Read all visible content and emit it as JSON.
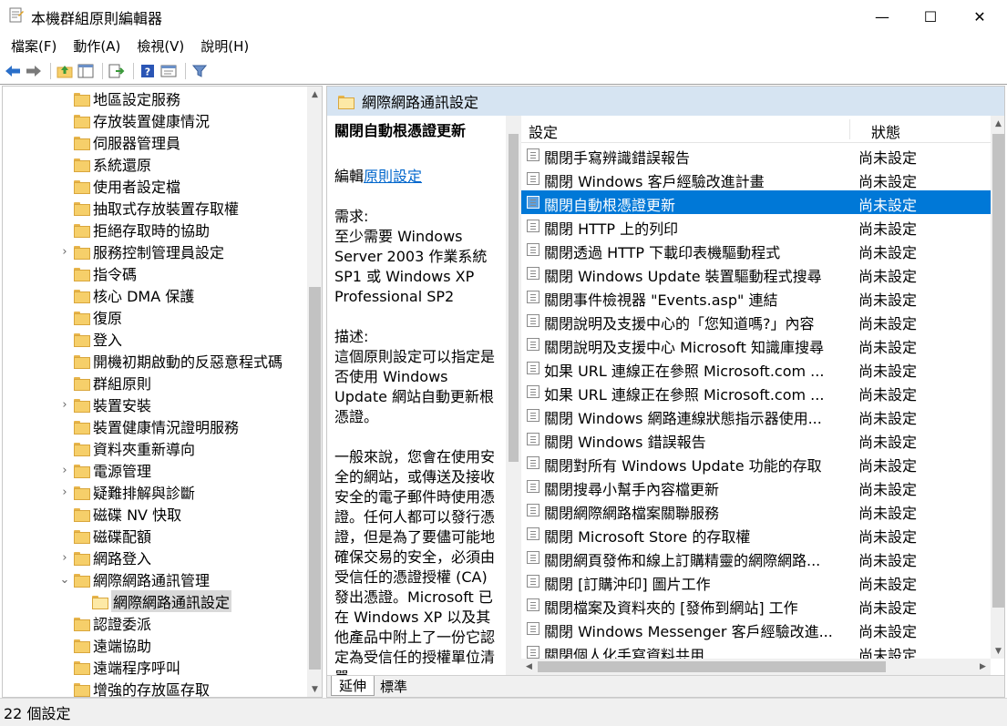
{
  "window": {
    "title": "本機群組原則編輯器",
    "minimize": "—",
    "maximize": "☐",
    "close": "✕"
  },
  "menu": [
    "檔案(F)",
    "動作(A)",
    "檢視(V)",
    "說明(H)"
  ],
  "tree": {
    "items": [
      {
        "label": "地區設定服務",
        "expandable": false
      },
      {
        "label": "存放裝置健康情況",
        "expandable": false
      },
      {
        "label": "伺服器管理員",
        "expandable": false
      },
      {
        "label": "系統還原",
        "expandable": false
      },
      {
        "label": "使用者設定檔",
        "expandable": false
      },
      {
        "label": "抽取式存放裝置存取權",
        "expandable": false
      },
      {
        "label": "拒絕存取時的協助",
        "expandable": false
      },
      {
        "label": "服務控制管理員設定",
        "expandable": true
      },
      {
        "label": "指令碼",
        "expandable": false
      },
      {
        "label": "核心 DMA 保護",
        "expandable": false
      },
      {
        "label": "復原",
        "expandable": false
      },
      {
        "label": "登入",
        "expandable": false
      },
      {
        "label": "開機初期啟動的反惡意程式碼",
        "expandable": false
      },
      {
        "label": "群組原則",
        "expandable": false
      },
      {
        "label": "裝置安裝",
        "expandable": true
      },
      {
        "label": "裝置健康情況證明服務",
        "expandable": false
      },
      {
        "label": "資料夾重新導向",
        "expandable": false
      },
      {
        "label": "電源管理",
        "expandable": true
      },
      {
        "label": "疑難排解與診斷",
        "expandable": true
      },
      {
        "label": "磁碟 NV 快取",
        "expandable": false
      },
      {
        "label": "磁碟配額",
        "expandable": false
      },
      {
        "label": "網路登入",
        "expandable": true
      },
      {
        "label": "網際網路通訊管理",
        "expandable": "open"
      },
      {
        "label": "網際網路通訊設定",
        "expandable": false,
        "child": true,
        "selected": true
      },
      {
        "label": "認證委派",
        "expandable": false
      },
      {
        "label": "遠端協助",
        "expandable": false
      },
      {
        "label": "遠端程序呼叫",
        "expandable": false
      },
      {
        "label": "增強的存放區存取",
        "expandable": false
      }
    ]
  },
  "right": {
    "header": "網際網路通訊設定",
    "description": {
      "title": "關閉自動根憑證更新",
      "edit_prefix": "編輯",
      "edit_link": "原則設定",
      "requirement_label": "需求:",
      "requirement_text": "至少需要 Windows Server 2003 作業系統 SP1 或 Windows XP Professional SP2",
      "description_label": "描述:",
      "description_text": "這個原則設定可以指定是否使用 Windows Update 網站自動更新根憑證。",
      "body_text": "一般來說，您會在使用安全的網站，或傳送及接收安全的電子郵件時使用憑證。任何人都可以發行憑證，但是為了要儘可能地確保交易的安全，必須由受信任的憑證授權 (CA) 發出憑證。Microsoft 已在 Windows XP 以及其他產品中附上了一份它認定為受信任的授權單位清單。"
    },
    "columns": {
      "setting": "設定",
      "state": "狀態"
    },
    "rows": [
      {
        "name": "關閉手寫辨識錯誤報告",
        "state": "尚未設定"
      },
      {
        "name": "關閉 Windows 客戶經驗改進計畫",
        "state": "尚未設定"
      },
      {
        "name": "關閉自動根憑證更新",
        "state": "尚未設定",
        "selected": true
      },
      {
        "name": "關閉 HTTP 上的列印",
        "state": "尚未設定"
      },
      {
        "name": "關閉透過 HTTP 下載印表機驅動程式",
        "state": "尚未設定"
      },
      {
        "name": "關閉 Windows Update 裝置驅動程式搜尋",
        "state": "尚未設定"
      },
      {
        "name": "關閉事件檢視器 \"Events.asp\" 連結",
        "state": "尚未設定"
      },
      {
        "name": "關閉說明及支援中心的「您知道嗎?」內容",
        "state": "尚未設定"
      },
      {
        "name": "關閉說明及支援中心 Microsoft 知識庫搜尋",
        "state": "尚未設定"
      },
      {
        "name": "如果 URL 連線正在參照 Microsoft.com ...",
        "state": "尚未設定"
      },
      {
        "name": "如果 URL 連線正在參照 Microsoft.com ...",
        "state": "尚未設定"
      },
      {
        "name": "關閉 Windows 網路連線狀態指示器使用...",
        "state": "尚未設定"
      },
      {
        "name": "關閉 Windows 錯誤報告",
        "state": "尚未設定"
      },
      {
        "name": "關閉對所有 Windows Update 功能的存取",
        "state": "尚未設定"
      },
      {
        "name": "關閉搜尋小幫手內容檔更新",
        "state": "尚未設定"
      },
      {
        "name": "關閉網際網路檔案關聯服務",
        "state": "尚未設定"
      },
      {
        "name": "關閉 Microsoft Store 的存取權",
        "state": "尚未設定"
      },
      {
        "name": "關閉網頁發佈和線上訂購精靈的網際網路...",
        "state": "尚未設定"
      },
      {
        "name": "關閉 [訂購沖印] 圖片工作",
        "state": "尚未設定"
      },
      {
        "name": "關閉檔案及資料夾的 [發佈到網站] 工作",
        "state": "尚未設定"
      },
      {
        "name": "關閉 Windows Messenger 客戶經驗改進...",
        "state": "尚未設定"
      },
      {
        "name": "關閉個人化手寫資料共用",
        "state": "尚未設定"
      }
    ],
    "tabs": [
      "延伸",
      "標準"
    ]
  },
  "status": "22 個設定"
}
